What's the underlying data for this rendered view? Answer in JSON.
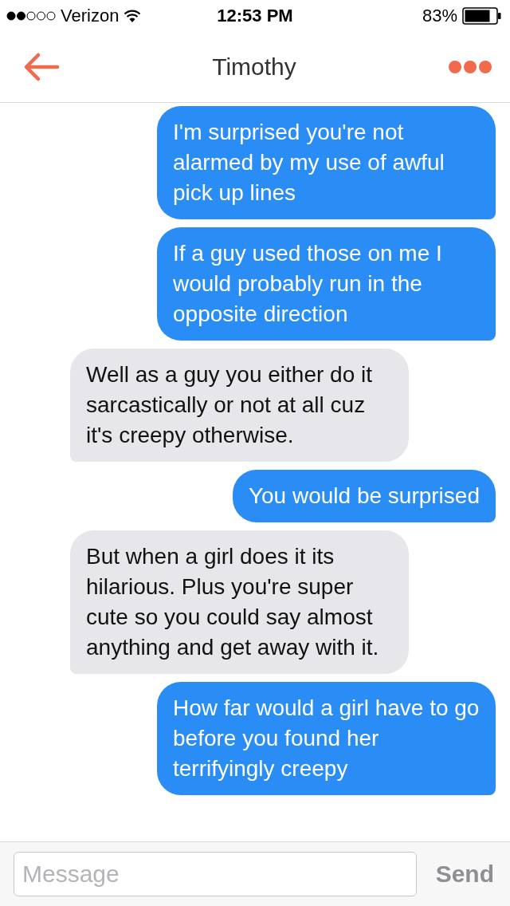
{
  "status_bar": {
    "carrier": "Verizon",
    "time": "12:53 PM",
    "battery": "83%"
  },
  "nav": {
    "title": "Timothy"
  },
  "messages": [
    {
      "kind": "outgoing",
      "text": "I'm surprised you're not alarmed by my use of awful pick up lines"
    },
    {
      "kind": "outgoing",
      "text": "If a guy used those on me I would probably run in the opposite direction"
    },
    {
      "kind": "incoming",
      "text": "Well as a guy you either do it sarcastically or not at all cuz it's creepy otherwise."
    },
    {
      "kind": "outgoing",
      "text": "You would be surprised"
    },
    {
      "kind": "incoming",
      "text": "But when a girl does it its hilarious. Plus you're super cute so you could say almost anything and get away with it."
    },
    {
      "kind": "outgoing",
      "text": "How far would a girl have to go before you found her terrifyingly creepy"
    }
  ],
  "composer": {
    "placeholder": "Message",
    "send": {
      "label": "Send",
      "disabled": true
    }
  }
}
